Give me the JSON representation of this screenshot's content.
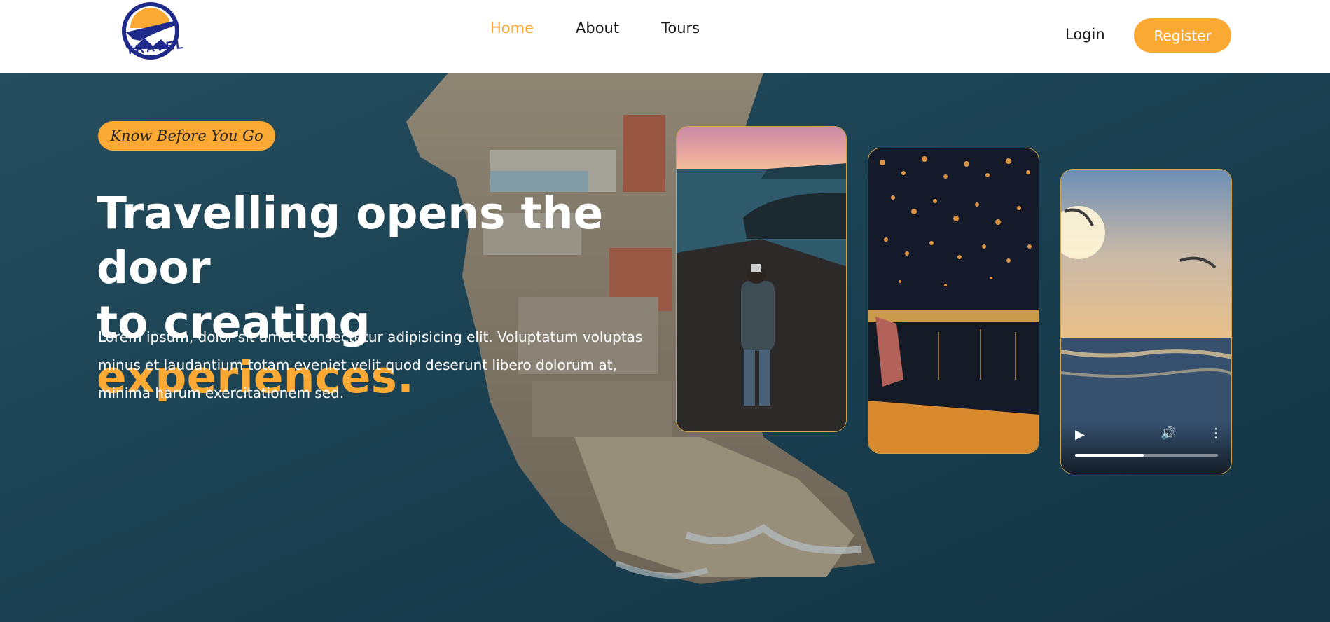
{
  "brand": {
    "logo_text": "TRAVEL",
    "colors": {
      "accent": "#faa935",
      "navy": "#1f2a8a"
    }
  },
  "nav": {
    "items": [
      {
        "label": "Home",
        "active": true
      },
      {
        "label": "About",
        "active": false
      },
      {
        "label": "Tours",
        "active": false
      }
    ],
    "login_label": "Login",
    "register_label": "Register"
  },
  "hero": {
    "tag": "Know Before You Go",
    "headline_line1": "Travelling opens the door",
    "headline_line2_prefix": "to creating ",
    "headline_accent": "experiences.",
    "lead": "Lorem ipsum, dolor sit amet consectetur adipisicing elit. Voluptatum voluptas minus et laudantium totam eveniet velit quod deserunt libero dolorum at, minima harum exercitationem sed."
  },
  "cards": [
    {
      "icon": "photo-traveler-cliff"
    },
    {
      "icon": "photo-lantern-festival"
    },
    {
      "icon": "video-sunset-sea",
      "progress": 0.48
    }
  ],
  "video_controls": {
    "play_icon": "play-icon",
    "volume_icon": "volume-icon",
    "menu_icon": "more-vertical-icon"
  }
}
